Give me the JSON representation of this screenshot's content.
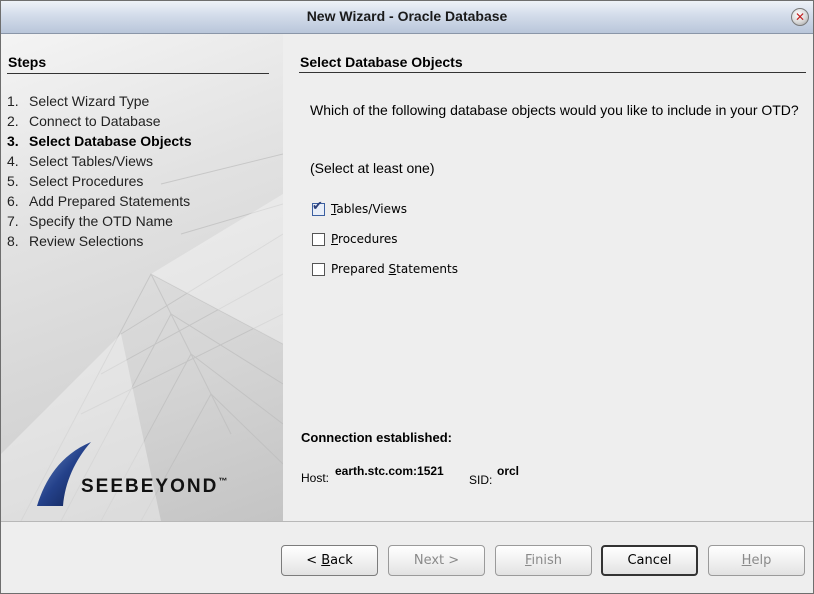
{
  "window": {
    "title": "New Wizard - Oracle Database"
  },
  "steps": {
    "heading": "Steps",
    "items": [
      {
        "num": "1.",
        "label": "Select Wizard Type"
      },
      {
        "num": "2.",
        "label": "Connect to Database"
      },
      {
        "num": "3.",
        "label": "Select Database Objects"
      },
      {
        "num": "4.",
        "label": "Select Tables/Views"
      },
      {
        "num": "5.",
        "label": "Select Procedures"
      },
      {
        "num": "6.",
        "label": "Add Prepared Statements"
      },
      {
        "num": "7.",
        "label": "Specify the OTD Name"
      },
      {
        "num": "8.",
        "label": "Review Selections"
      }
    ],
    "active_index": 2,
    "logo_text": "SEEBEYOND",
    "logo_tm": "™"
  },
  "content": {
    "title": "Select Database Objects",
    "question": "Which of the following database objects would you like to include in your OTD?",
    "hint": "(Select at least one)",
    "options": [
      {
        "pre": "",
        "mnemonic": "T",
        "post": "ables/Views",
        "checked": true
      },
      {
        "pre": "",
        "mnemonic": "P",
        "post": "rocedures",
        "checked": false
      },
      {
        "pre": "Prepared ",
        "mnemonic": "S",
        "post": "tatements",
        "checked": false
      }
    ],
    "connection": {
      "heading": "Connection established:",
      "host_label": "Host:",
      "host_value": "earth.stc.com:1521",
      "sid_label": "SID:",
      "sid_value": "orcl"
    }
  },
  "buttons": {
    "back": {
      "pre": "< ",
      "mnemonic": "B",
      "post": "ack"
    },
    "next": {
      "label": "Next >"
    },
    "finish": {
      "mnemonic": "F",
      "post": "inish"
    },
    "cancel": {
      "label": "Cancel"
    },
    "help": {
      "mnemonic": "H",
      "post": "elp"
    }
  },
  "colors": {
    "titlebar": "#c9d3e3",
    "background": "#eeeeee",
    "close_x": "#c02020"
  }
}
